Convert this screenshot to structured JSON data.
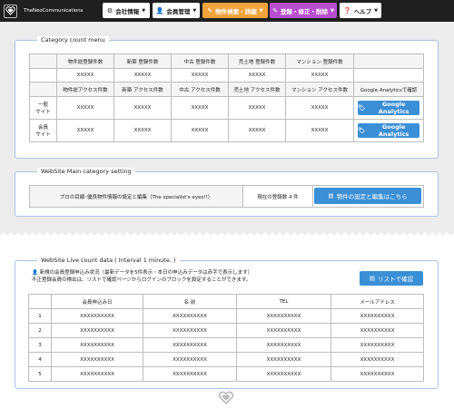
{
  "header": {
    "brand": "TheNeoCommunications",
    "nav": [
      {
        "label": "会社情報",
        "icon": "gear-icon"
      },
      {
        "label": "会員管理",
        "icon": "user-icon"
      },
      {
        "label": "物件検索・詳細",
        "icon": "edit-icon"
      },
      {
        "label": "登録・修正・削除",
        "icon": "edit-icon"
      },
      {
        "label": "ヘルプ",
        "icon": "help-icon"
      }
    ]
  },
  "category": {
    "title": "Category count menu",
    "reg_headers": [
      "物件総登録件数",
      "新築 登録件数",
      "中古 登録件数",
      "売土地 登録件数",
      "マンション 登録件数"
    ],
    "reg_values": [
      "XXXXX",
      "XXXXX",
      "XXXXX",
      "XXXXX",
      "XXXXX"
    ],
    "access_headers": [
      "物件総アクセス件数",
      "新築 アクセス件数",
      "中古 アクセス件数",
      "売土地 アクセス件数",
      "マンション アクセス件数",
      "Google Analyticsで確認"
    ],
    "rows": [
      {
        "label1": "一般",
        "label2": "サイト",
        "values": [
          "XXXXX",
          "XXXXX",
          "XXXXX",
          "XXXXX",
          "XXXXX"
        ]
      },
      {
        "label1": "会員",
        "label2": "サイト",
        "values": [
          "XXXXX",
          "XXXXX",
          "XXXXX",
          "XXXXX",
          "XXXXX"
        ]
      }
    ],
    "ga_label": "Google Analytics"
  },
  "main_cat": {
    "title": "WebSite Main category setting",
    "desc": "プロの目線･優良物件情報の設定と編集（The specialist's eyes!!）",
    "count": "現在の登録数 4 件",
    "button": "物件の設定と編集はこちら"
  },
  "live": {
    "title": "WebSite Live count data ( Interval 1 minute. )",
    "notice1": "新規の会員登録申込み状況（最新データを5件表示・本日の申込みデータは赤字で表示します）",
    "notice2": "不正登録会員の検出は、リストで確認ページからログインのブロックを設定することができます。",
    "list_button": "リストで確認",
    "headers": [
      "",
      "会員申込み日",
      "名 前",
      "TEL",
      "メールアドレス"
    ],
    "rows": [
      {
        "no": "1",
        "date": "XXXXXXXXXX",
        "name": "XXXXXXXXXX",
        "tel": "XXXXXXXXXX",
        "mail": "XXXXXXXXXX"
      },
      {
        "no": "2",
        "date": "XXXXXXXXXX",
        "name": "XXXXXXXXXX",
        "tel": "XXXXXXXXXX",
        "mail": "XXXXXXXXXX"
      },
      {
        "no": "3",
        "date": "XXXXXXXXXX",
        "name": "XXXXXXXXXX",
        "tel": "XXXXXXXXXX",
        "mail": "XXXXXXXXXX"
      },
      {
        "no": "4",
        "date": "XXXXXXXXXX",
        "name": "XXXXXXXXXX",
        "tel": "XXXXXXXXXX",
        "mail": "XXXXXXXXXX"
      },
      {
        "no": "5",
        "date": "XXXXXXXXXX",
        "name": "XXXXXXXXXX",
        "tel": "XXXXXXXXXX",
        "mail": "XXXXXXXXXX"
      }
    ]
  },
  "colors": {
    "header_bg": "#1f1f1f",
    "accent_blue": "#3a8fd6",
    "orange": "#f2a43b",
    "purple": "#b84fcf",
    "panel_border": "#a9c4e6"
  }
}
